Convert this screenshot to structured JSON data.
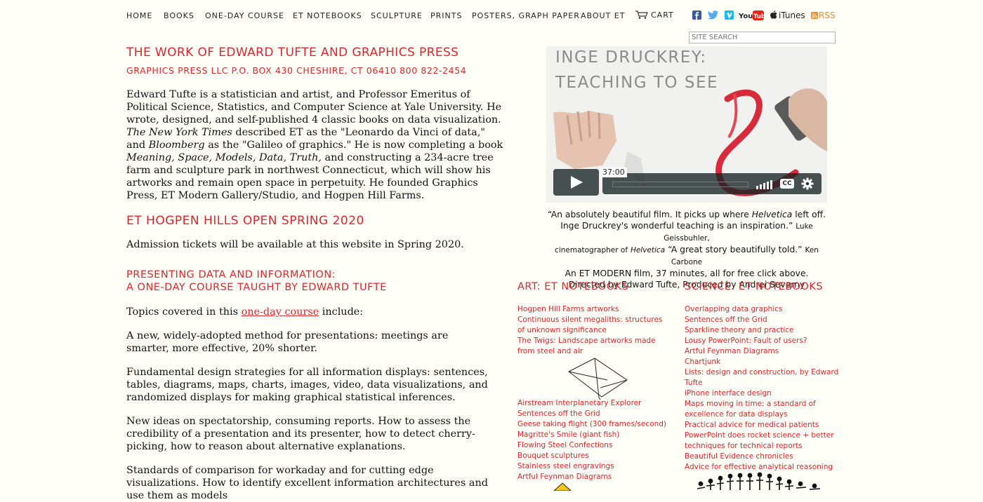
{
  "nav": {
    "items": [
      "HOME",
      "BOOKS",
      "ONE-DAY COURSE",
      "ET NOTEBOOKS",
      "SCULPTURE",
      "PRINTS",
      "POSTERS, GRAPH PAPER",
      "ABOUT ET"
    ],
    "cart": "CART",
    "itunes": "iTunes",
    "rss": "RSS",
    "youtube": "YouTube"
  },
  "search": {
    "placeholder": "SITE SEARCH"
  },
  "header": {
    "title": "THE WORK OF EDWARD TUFTE AND GRAPHICS PRESS",
    "subtitle": "GRAPHICS PRESS LLC  P.O. BOX 430  CHESHIRE, CT 06410  800 822-2454"
  },
  "intro": {
    "p1": "Edward Tufte is a statistician and artist, and Professor Emeritus of Political Science, Statistics, and Computer Science at Yale University. He wrote, designed, and self-published 4 classic books on data visualization.",
    "nyt": "The New York Times",
    "p2": "described ET as the \"Leonardo da Vinci of data,\" and",
    "bloomberg": "Bloomberg",
    "p3": "as the \"Galileo of graphics.\" He is now completing a book",
    "book": "Meaning, Space, Models, Data, Truth,",
    "p4": "and constructing a 234-acre tree farm and sculpture park in northwest Connecticut, which will show his artworks and remain open space in perpetuity. He founded Graphics Press, ET Modern Gallery/Studio, and Hogpen Hill Farms."
  },
  "hogpen": {
    "title": "ET HOGPEN HILLS OPEN SPRING 2020",
    "text": "Admission tickets will be available at this website in Spring 2020."
  },
  "course": {
    "title1": "PRESENTING DATA AND INFORMATION:",
    "title2": "A ONE-DAY COURSE TAUGHT BY EDWARD TUFTE",
    "topics_pre": "Topics covered in this",
    "topics_link": "one-day course",
    "topics_post": "include:",
    "p1": "A new, widely-adopted method for presentations: meetings are smarter, more effective, 20% shorter.",
    "p2": "Fundamental design strategies for all information displays: sentences, tables, diagrams, maps, charts, images, video, data visualizations, and randomized displays for making graphical statistical inferences.",
    "p3": "New ideas on spectatorship, consuming reports. How to assess the credibility of a presentation and its presenter, how to detect cherry-picking, how to reason about alternative explanations.",
    "p4": "Standards of comparison for workaday and for cutting edge visualizations. How to identify excellent information architectures and use them as models"
  },
  "video": {
    "title1": "INGE DRUCKREY:",
    "title2": "TEACHING TO SEE",
    "duration": "37:00",
    "cc": "CC"
  },
  "quote": {
    "q1a": "“An absolutely beautiful film. It picks up where",
    "q1i": "Helvetica",
    "q1b": "left off.",
    "q2": "Inge Druckrey's wonderful teaching is an inspiration.”",
    "a1": "Luke Geissbuhler,",
    "a2": "cinematographer of",
    "a2i": "Helvetica",
    "q3": "“A great story beautifully told.”",
    "a3": "Ken Carbone",
    "l4": "An ET MODERN film, 37 minutes, all for free click above.",
    "l5": "Directed by Edward Tufte, Produced by Andrei Severny"
  },
  "art": {
    "title": "ART: ET NOTEBOOKS",
    "links_top": [
      "Hogpen Hill Farms artworks",
      "Continuous silent megaliths: structures of unknown significance",
      "The Twigs: Landscape artworks made from steel and air"
    ],
    "links_bottom": [
      "Airstream Interplanetary Explorer",
      "Sentences off the Grid",
      "Geese taking flight (300 frames/second)",
      "Magritte's Smile (giant fish)",
      "Flowing Steel Confections",
      "Bouquet sculptures",
      "Stainless steel engravings",
      "Artful Feynman Diagrams"
    ]
  },
  "science": {
    "title": "SCIENCE: ET NOTEBOOKS",
    "links": [
      "Overlapping data graphics",
      "Sentences off the Grid",
      "Sparkline theory and practice",
      "Lousy PowerPoint: Fault of users?",
      "Artful Feynman Diagrams",
      "Chartjunk",
      "Lists: design and construction, by Edward Tufte",
      "iPhone interface design",
      "Maps moving in time: a standard of excellence for data displays",
      "Practical advice for medical patients",
      "PowerPoint does rocket science + better techniques for technical reports",
      "Beautiful Evidence chronicles",
      "Advice for effective analytical reasoning"
    ]
  },
  "colors": {
    "accent": "#d8262c",
    "background": "#fffff8"
  }
}
